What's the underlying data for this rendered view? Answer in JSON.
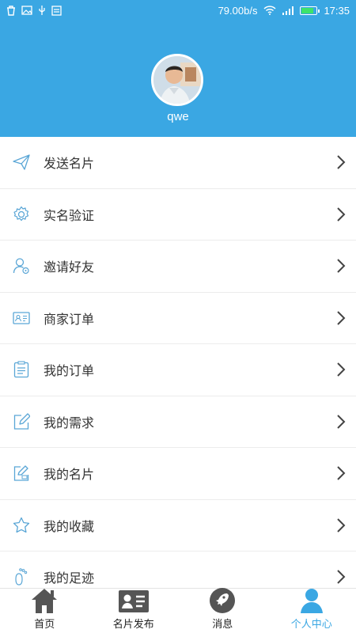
{
  "status_bar": {
    "net_speed": "79.00b/s",
    "time": "17:35",
    "battery_level": 0.9
  },
  "profile": {
    "username": "qwe"
  },
  "menu": {
    "items": [
      {
        "label": "发送名片",
        "icon": "send-icon"
      },
      {
        "label": "实名验证",
        "icon": "gear-icon"
      },
      {
        "label": "邀请好友",
        "icon": "invite-user-icon"
      },
      {
        "label": "商家订单",
        "icon": "id-card-icon"
      },
      {
        "label": "我的订单",
        "icon": "clipboard-icon"
      },
      {
        "label": "我的需求",
        "icon": "edit-icon"
      },
      {
        "label": "我的名片",
        "icon": "card-edit-icon"
      },
      {
        "label": "我的收藏",
        "icon": "star-icon"
      },
      {
        "label": "我的足迹",
        "icon": "footprint-icon"
      }
    ]
  },
  "tabbar": {
    "tabs": [
      {
        "label": "首页",
        "icon": "home-icon",
        "active": false
      },
      {
        "label": "名片发布",
        "icon": "business-card-icon",
        "active": false
      },
      {
        "label": "消息",
        "icon": "rocket-icon",
        "active": false
      },
      {
        "label": "个人中心",
        "icon": "person-icon",
        "active": true
      }
    ]
  },
  "colors": {
    "primary": "#3aa7e3",
    "icon_stroke": "#5aa6d6",
    "tab_inactive": "#555555"
  }
}
